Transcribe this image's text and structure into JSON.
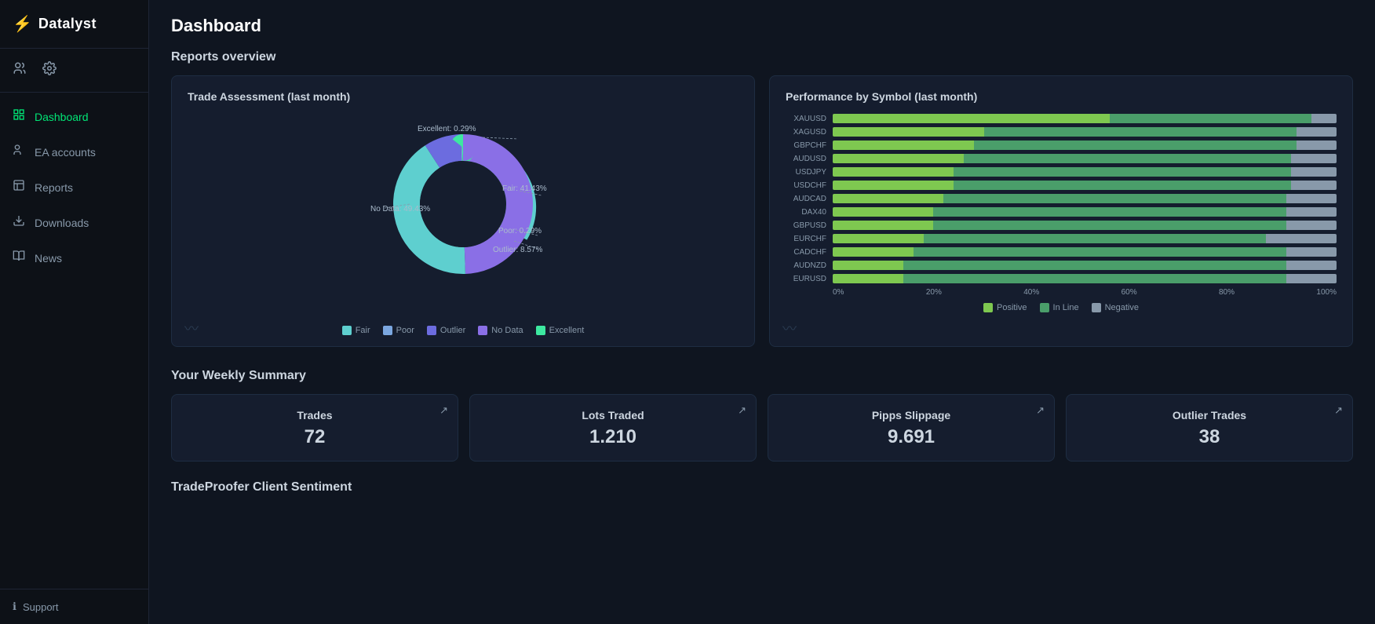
{
  "app": {
    "logo": "Datalyst",
    "logo_icon": "⚡"
  },
  "sidebar": {
    "items": [
      {
        "id": "dashboard",
        "label": "Dashboard",
        "icon": "⊞",
        "active": true
      },
      {
        "id": "ea-accounts",
        "label": "EA accounts",
        "icon": "👥"
      },
      {
        "id": "reports",
        "label": "Reports",
        "icon": "📋"
      },
      {
        "id": "downloads",
        "label": "Downloads",
        "icon": "⬇"
      },
      {
        "id": "news",
        "label": "News",
        "icon": "📖"
      }
    ],
    "support_label": "Support"
  },
  "header": {
    "page_title": "Dashboard",
    "reports_overview_title": "Reports overview"
  },
  "trade_assessment": {
    "title": "Trade Assessment (last month)",
    "segments": [
      {
        "label": "Fair",
        "value": 41.43,
        "color": "#5ecfcf"
      },
      {
        "label": "Poor",
        "value": 0.29,
        "color": "#7ba7e0"
      },
      {
        "label": "Outlier",
        "value": 8.57,
        "color": "#6c6cdf"
      },
      {
        "label": "No Data",
        "value": 49.43,
        "color": "#8a6fe6"
      },
      {
        "label": "Excellent",
        "value": 0.29,
        "color": "#5ecfcf"
      }
    ],
    "labels": {
      "excellent": "Excellent: 0.29%",
      "fair": "Fair: 41.43%",
      "poor": "Poor: 0.29%",
      "outlier": "Outlier: 8.57%",
      "nodata": "No Data: 49.43%"
    },
    "legend": [
      {
        "label": "Fair",
        "color": "#5ecfcf"
      },
      {
        "label": "Poor",
        "color": "#7ba7e0"
      },
      {
        "label": "Outlier",
        "color": "#6c6cdf"
      },
      {
        "label": "No Data",
        "color": "#8a6fe6"
      },
      {
        "label": "Excellent",
        "color": "#3de8a0"
      }
    ]
  },
  "performance_by_symbol": {
    "title": "Performance by Symbol (last month)",
    "symbols": [
      {
        "name": "XAUUSD",
        "positive": 55,
        "inline": 40,
        "negative": 5
      },
      {
        "name": "XAGUSD",
        "positive": 30,
        "inline": 62,
        "negative": 8
      },
      {
        "name": "GBPCHF",
        "positive": 28,
        "inline": 64,
        "negative": 8
      },
      {
        "name": "AUDUSD",
        "positive": 26,
        "inline": 65,
        "negative": 9
      },
      {
        "name": "USDJPY",
        "positive": 24,
        "inline": 67,
        "negative": 9
      },
      {
        "name": "USDCHF",
        "positive": 24,
        "inline": 67,
        "negative": 9
      },
      {
        "name": "AUDCAD",
        "positive": 22,
        "inline": 68,
        "negative": 10
      },
      {
        "name": "DAX40",
        "positive": 20,
        "inline": 70,
        "negative": 10
      },
      {
        "name": "GBPUSD",
        "positive": 20,
        "inline": 70,
        "negative": 10
      },
      {
        "name": "EURCHF",
        "positive": 18,
        "inline": 68,
        "negative": 14
      },
      {
        "name": "CADCHF",
        "positive": 16,
        "inline": 74,
        "negative": 10
      },
      {
        "name": "AUDNZD",
        "positive": 14,
        "inline": 76,
        "negative": 10
      },
      {
        "name": "EURUSD",
        "positive": 14,
        "inline": 76,
        "negative": 10
      }
    ],
    "x_labels": [
      "0%",
      "20%",
      "40%",
      "60%",
      "80%",
      "100%"
    ],
    "legend": [
      {
        "label": "Positive",
        "color": "#7ec850"
      },
      {
        "label": "In Line",
        "color": "#4a9e6a"
      },
      {
        "label": "Negative",
        "color": "#8899aa"
      }
    ]
  },
  "weekly_summary": {
    "title": "Your Weekly Summary",
    "cards": [
      {
        "id": "trades",
        "label": "Trades",
        "value": "72"
      },
      {
        "id": "lots-traded",
        "label": "Lots Traded",
        "value": "1.210"
      },
      {
        "id": "pipps-slippage",
        "label": "Pipps Slippage",
        "value": "9.691"
      },
      {
        "id": "outlier-trades",
        "label": "Outlier Trades",
        "value": "38"
      }
    ]
  },
  "sentiment": {
    "title": "TradeProofer Client Sentiment"
  }
}
